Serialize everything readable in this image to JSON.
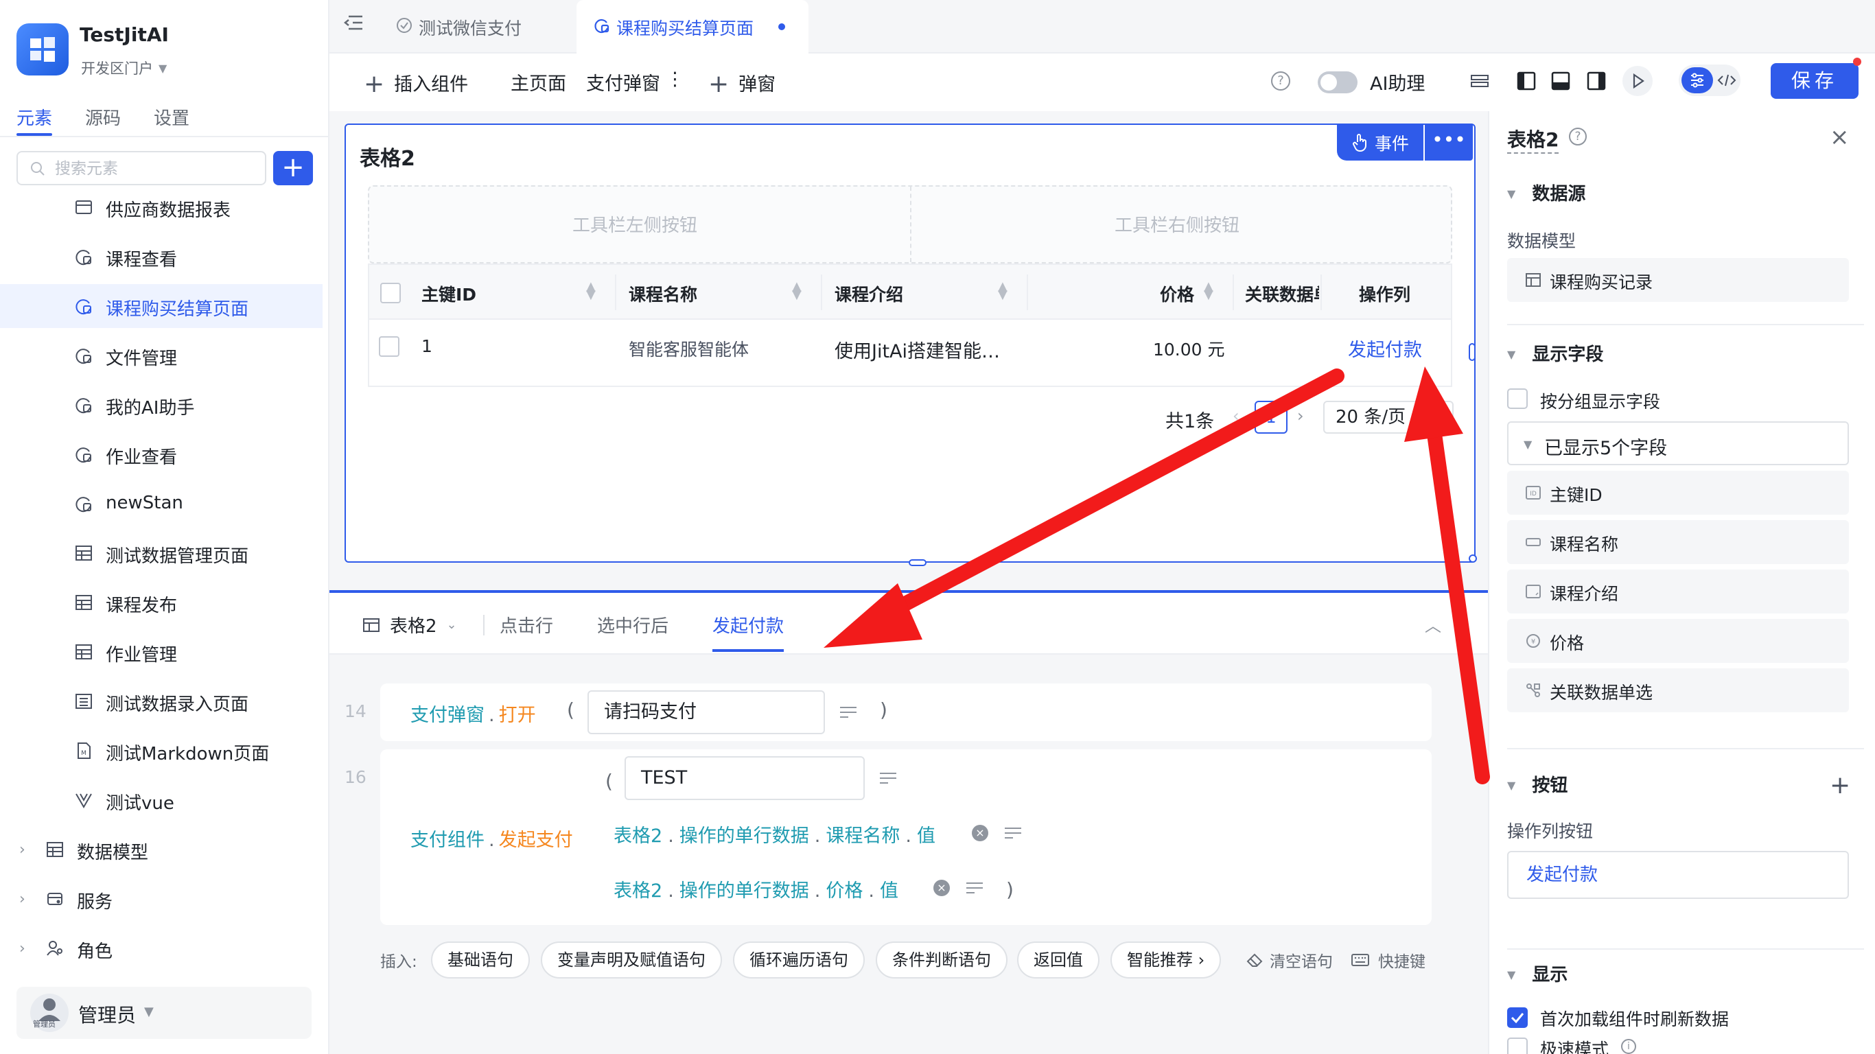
{
  "app": {
    "title": "TestJitAI",
    "portal": "开发区门户"
  },
  "sidebar": {
    "tabs": [
      "元素",
      "源码",
      "设置"
    ],
    "search_placeholder": "搜索元素",
    "items": [
      {
        "label": "供应商数据报表",
        "icon": "report-icon"
      },
      {
        "label": "课程查看",
        "icon": "page-icon"
      },
      {
        "label": "课程购买结算页面",
        "icon": "page-icon",
        "active": true
      },
      {
        "label": "文件管理",
        "icon": "page-icon"
      },
      {
        "label": "我的AI助手",
        "icon": "page-icon"
      },
      {
        "label": "作业查看",
        "icon": "page-icon"
      },
      {
        "label": "newStan",
        "icon": "page-icon"
      },
      {
        "label": "测试数据管理页面",
        "icon": "table-icon"
      },
      {
        "label": "课程发布",
        "icon": "table-icon"
      },
      {
        "label": "作业管理",
        "icon": "table-icon"
      },
      {
        "label": "测试数据录入页面",
        "icon": "form-icon"
      },
      {
        "label": "测试Markdown页面",
        "icon": "markdown-icon"
      },
      {
        "label": "测试vue",
        "icon": "vue-icon"
      }
    ],
    "groups": [
      {
        "label": "数据模型",
        "icon": "table-icon"
      },
      {
        "label": "服务",
        "icon": "service-icon"
      },
      {
        "label": "角色",
        "icon": "role-icon"
      }
    ],
    "user": {
      "name": "管理员",
      "avatar_caption": "管理员"
    }
  },
  "tabs": [
    {
      "label": "测试微信支付"
    },
    {
      "label": "课程购买结算页面",
      "active": true
    }
  ],
  "toolbar": {
    "insert": "插入组件",
    "main_page": "主页面",
    "pay_popup": "支付弹窗",
    "more": "⋮",
    "popup": "弹窗",
    "ai_label": "AI助理",
    "save": "保存"
  },
  "table": {
    "title": "表格2",
    "event_button": "事件",
    "more": "•••",
    "toolbar_left": "工具栏左侧按钮",
    "toolbar_right": "工具栏右侧按钮",
    "columns": [
      "主键ID",
      "课程名称",
      "课程介绍",
      "价格",
      "关联数据单",
      "操作列"
    ],
    "rows": [
      {
        "id": "1",
        "name": "智能客服智能体",
        "intro": "使用JitAi搭建智能…",
        "price": "10.00 元",
        "action": "发起付款"
      }
    ],
    "pager": {
      "total": "共1条",
      "page": "1",
      "size": "20 条/页",
      "prev": "‹",
      "next": "›"
    }
  },
  "bottom": {
    "component": "表格2",
    "tabs": [
      "点击行",
      "选中行后",
      "发起付款"
    ],
    "active_tab": "发起付款",
    "code": {
      "line14": {
        "num": "14",
        "obj": "支付弹窗",
        "method": "打开",
        "open_paren": "(",
        "close_paren": ")",
        "arg": "请扫码支付"
      },
      "line16": {
        "num": "16",
        "obj": "支付组件",
        "method": "发起支付",
        "open_paren": "(",
        "close_paren": ")",
        "arg1": "TEST",
        "arg2": [
          "表格2",
          "操作的单行数据",
          "课程名称",
          "值"
        ],
        "arg3": [
          "表格2",
          "操作的单行数据",
          "价格",
          "值"
        ]
      }
    },
    "insert_label": "插入:",
    "chips": [
      "基础语句",
      "变量声明及赋值语句",
      "循环遍历语句",
      "条件判断语句",
      "返回值",
      "智能推荐 ›"
    ],
    "clear": "清空语句",
    "shortcut": "快捷键"
  },
  "right_panel": {
    "title": "表格2",
    "datasource_section": "数据源",
    "data_model_label": "数据模型",
    "data_model_value": "课程购买记录",
    "display_fields_section": "显示字段",
    "group_display": "按分组显示字段",
    "shown_fields": "已显示5个字段",
    "fields": [
      "主键ID",
      "课程名称",
      "课程介绍",
      "价格",
      "关联数据单选"
    ],
    "buttons_section": "按钮",
    "action_buttons_label": "操作列按钮",
    "action_button_value": "发起付款",
    "display_section": "显示",
    "refresh_on_load": "首次加载组件时刷新数据",
    "fast_mode": "极速模式"
  },
  "colors": {
    "accent": "#2f5bea",
    "arrow": "#f21b1b",
    "code_object": "#1f9bb0",
    "code_method": "#f5871f"
  }
}
